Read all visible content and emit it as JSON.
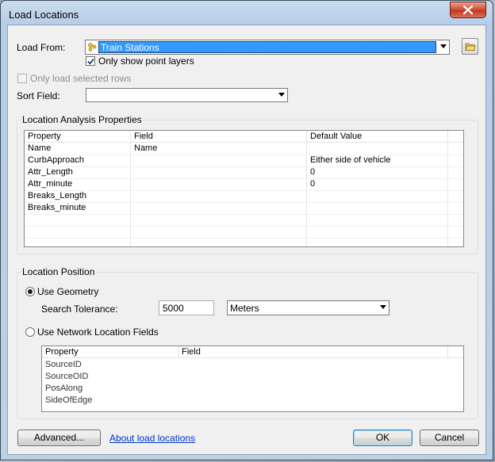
{
  "window": {
    "title": "Load Locations",
    "close_icon": "close-icon"
  },
  "load_from": {
    "label": "Load From:",
    "value": "Train Stations",
    "layer_icon": "point-layer-icon",
    "browse_icon": "open-folder-icon"
  },
  "only_point_layers": {
    "label": "Only show point layers",
    "checked": true
  },
  "only_selected_rows": {
    "label": "Only load selected rows",
    "checked": false,
    "enabled": false
  },
  "sort_field": {
    "label": "Sort Field:",
    "value": ""
  },
  "analysis_properties": {
    "title": "Location Analysis Properties",
    "columns": [
      "Property",
      "Field",
      "Default Value"
    ],
    "rows": [
      {
        "property": "Name",
        "field": "Name",
        "default": ""
      },
      {
        "property": "CurbApproach",
        "field": "",
        "default": "Either side of vehicle"
      },
      {
        "property": "Attr_Length",
        "field": "",
        "default": "0"
      },
      {
        "property": "Attr_minute",
        "field": "",
        "default": "0"
      },
      {
        "property": "Breaks_Length",
        "field": "",
        "default": ""
      },
      {
        "property": "Breaks_minute",
        "field": "",
        "default": ""
      }
    ]
  },
  "location_position": {
    "title": "Location Position",
    "use_geometry": {
      "label": "Use Geometry",
      "selected": true
    },
    "search_tolerance": {
      "label": "Search Tolerance:",
      "value": "5000",
      "unit": "Meters"
    },
    "use_network_fields": {
      "label": "Use Network Location Fields",
      "selected": false
    },
    "columns": [
      "Property",
      "Field"
    ],
    "rows": [
      {
        "property": "SourceID",
        "field": ""
      },
      {
        "property": "SourceOID",
        "field": ""
      },
      {
        "property": "PosAlong",
        "field": ""
      },
      {
        "property": "SideOfEdge",
        "field": ""
      }
    ]
  },
  "footer": {
    "advanced": "Advanced...",
    "about_link": "About load locations",
    "ok": "OK",
    "cancel": "Cancel"
  },
  "colors": {
    "selection": "#3399ff",
    "link": "#0033cc",
    "close_button": "#c23820"
  }
}
